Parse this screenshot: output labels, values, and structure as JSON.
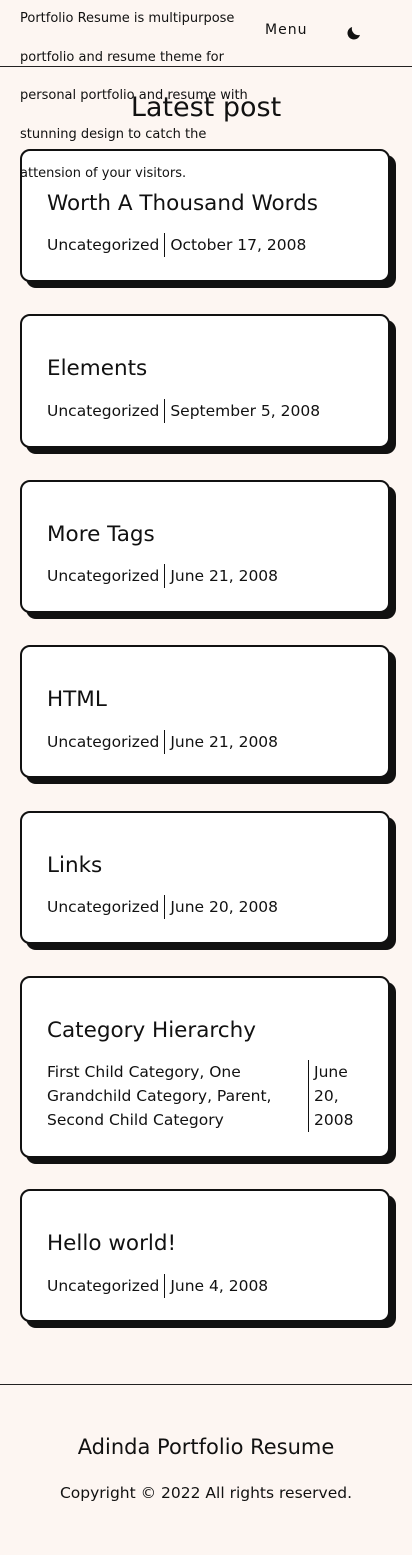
{
  "header": {
    "tagline": "Portfolio Resume is multipurpose portfolio and resume theme for personal portfolio and resume with stunning design to catch the attension of your visitors.",
    "menu_label": "Menu",
    "theme_toggle_icon": "moon-icon"
  },
  "main": {
    "title": "Latest post",
    "posts": [
      {
        "title": "Worth A Thousand Words",
        "category": "Uncategorized",
        "date": "October 17, 2008"
      },
      {
        "title": "Elements",
        "category": "Uncategorized",
        "date": "September 5, 2008"
      },
      {
        "title": "More Tags",
        "category": "Uncategorized",
        "date": "June 21, 2008"
      },
      {
        "title": "HTML",
        "category": "Uncategorized",
        "date": "June 21, 2008"
      },
      {
        "title": "Links",
        "category": "Uncategorized",
        "date": "June 20, 2008"
      },
      {
        "title": "Category Hierarchy",
        "category": "First Child Category, One Grandchild Category, Parent, Second Child Category",
        "date": "June 20, 2008"
      },
      {
        "title": "Hello world!",
        "category": "Uncategorized",
        "date": "June 4, 2008"
      }
    ]
  },
  "footer": {
    "site_title": "Adinda Portfolio Resume",
    "copyright": "Copyright © 2022 All rights reserved."
  }
}
